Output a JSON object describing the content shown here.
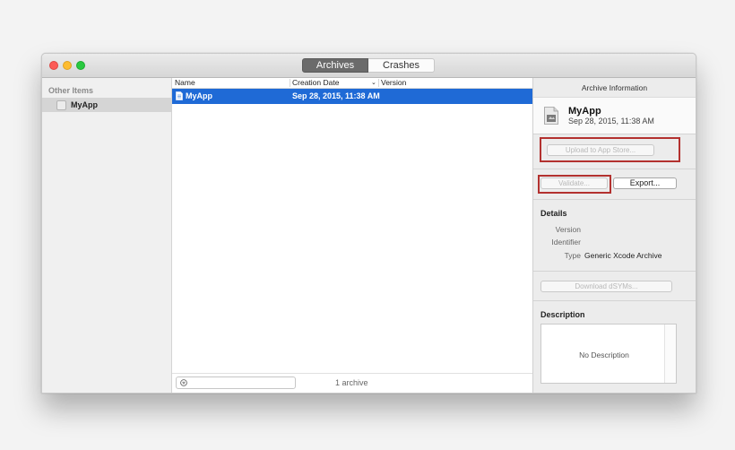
{
  "window": {
    "tabs": [
      {
        "label": "Archives",
        "selected": true
      },
      {
        "label": "Crashes",
        "selected": false
      }
    ]
  },
  "sidebar": {
    "header": "Other Items",
    "items": [
      {
        "label": "MyApp",
        "selected": true
      }
    ]
  },
  "archive_list": {
    "columns": [
      "Name",
      "Creation Date",
      "Version"
    ],
    "sorted_column": "Creation Date",
    "rows": [
      {
        "name": "MyApp",
        "creation_date": "Sep 28, 2015, 11:38 AM",
        "version": "",
        "selected": true
      }
    ],
    "filter_placeholder": "",
    "count_label": "1 archive"
  },
  "inspector": {
    "title": "Archive Information",
    "archive_name": "MyApp",
    "archive_date": "Sep 28, 2015, 11:38 AM",
    "upload_label": "Upload to App Store...",
    "validate_label": "Validate...",
    "export_label": "Export...",
    "details_title": "Details",
    "details": [
      {
        "label": "Version",
        "value": ""
      },
      {
        "label": "Identifier",
        "value": ""
      },
      {
        "label": "Type",
        "value": "Generic Xcode Archive"
      }
    ],
    "download_dsyms_label": "Download dSYMs...",
    "description_title": "Description",
    "description_text": "No Description"
  },
  "colors": {
    "selection": "#1f6ad6",
    "annotation_highlight": "#b3312f",
    "close": "#fc5b57",
    "minimize": "#fdbc2f",
    "zoom": "#29c940"
  }
}
